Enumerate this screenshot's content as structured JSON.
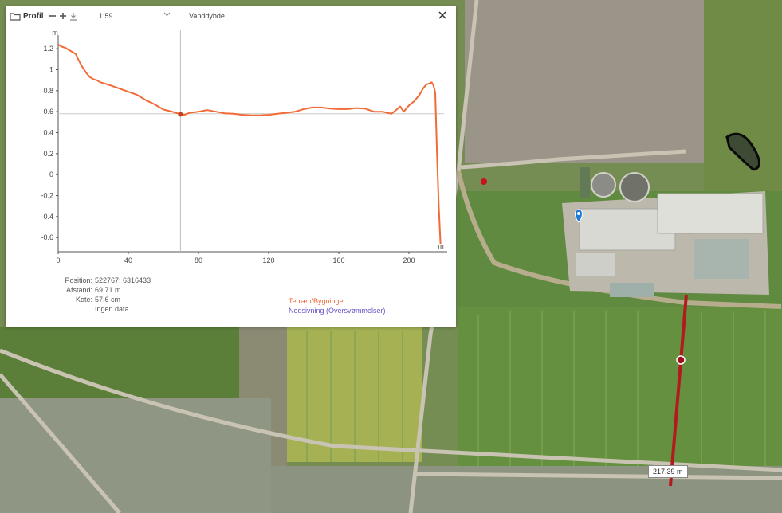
{
  "toolbar": {
    "title": "Profil",
    "scale_value": "1:59",
    "layer_label": "Vanddybde"
  },
  "chart_data": {
    "type": "line",
    "title": "",
    "xlabel": "",
    "ylabel": "",
    "y_unit": "m",
    "x_unit": "m",
    "xlim": [
      0,
      220
    ],
    "ylim": [
      -0.72,
      1.3
    ],
    "x_ticks": [
      0,
      40,
      80,
      120,
      160,
      200
    ],
    "y_ticks": [
      1.2,
      1,
      0.8,
      0.6,
      0.4,
      0.2,
      0,
      -0.2,
      -0.4,
      -0.6
    ],
    "y_tick_labels": [
      "1.2",
      "1",
      "0.8",
      "0.6",
      "0.4",
      "0.2",
      "0",
      "-0.2",
      "-0.4",
      "-0.6"
    ],
    "grid": false,
    "cursor": {
      "x": 69.71,
      "y": 0.576
    },
    "reference_line_y": 0.58,
    "series": [
      {
        "name": "Terræn/Bygninger",
        "color": "#f26a35",
        "x": [
          0,
          2,
          4,
          6,
          8,
          10,
          12,
          14,
          16,
          18,
          20,
          22,
          24,
          26,
          28,
          30,
          35,
          40,
          45,
          50,
          55,
          60,
          65,
          69.7,
          72,
          75,
          80,
          85,
          90,
          95,
          100,
          105,
          110,
          115,
          120,
          125,
          130,
          135,
          140,
          145,
          150,
          155,
          160,
          165,
          170,
          175,
          180,
          185,
          190,
          193,
          195,
          197,
          200,
          203,
          206,
          208,
          210,
          212,
          213,
          214,
          215,
          216,
          217,
          218
        ],
        "y": [
          1.24,
          1.22,
          1.21,
          1.19,
          1.17,
          1.15,
          1.08,
          1.02,
          0.97,
          0.93,
          0.91,
          0.9,
          0.88,
          0.87,
          0.86,
          0.85,
          0.82,
          0.79,
          0.76,
          0.71,
          0.67,
          0.62,
          0.6,
          0.576,
          0.57,
          0.59,
          0.6,
          0.615,
          0.6,
          0.585,
          0.58,
          0.57,
          0.565,
          0.565,
          0.57,
          0.58,
          0.59,
          0.6,
          0.625,
          0.64,
          0.64,
          0.63,
          0.625,
          0.625,
          0.635,
          0.63,
          0.6,
          0.6,
          0.58,
          0.62,
          0.65,
          0.6,
          0.66,
          0.7,
          0.76,
          0.82,
          0.86,
          0.87,
          0.88,
          0.85,
          0.78,
          0.2,
          -0.3,
          -0.66
        ]
      },
      {
        "name": "Nedsivning (Oversvømmelser)",
        "color": "#6a52c9",
        "x": [],
        "y": []
      }
    ]
  },
  "info": {
    "position_label": "Position:",
    "position_value": "522767; 6316433",
    "distance_label": "Afstand:",
    "distance_value": "69,71 m",
    "elevation_label": "Kote:",
    "elevation_value": "57,6 cm",
    "no_data": "Ingen data"
  },
  "map": {
    "measure_label": "217,39 m"
  }
}
